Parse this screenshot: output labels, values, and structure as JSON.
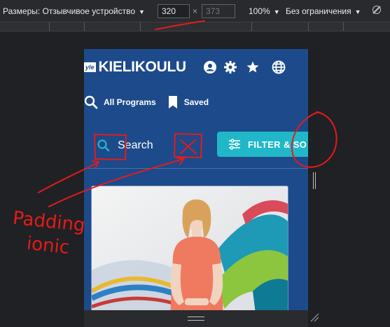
{
  "devtools": {
    "dimensions_label": "Размеры: Отзывчивое устройство",
    "width_value": "320",
    "height_placeholder": "373",
    "zoom_label": "100%",
    "throttle_label": "Без ограничения"
  },
  "app": {
    "logo_badge": "yle",
    "logo_text_bold": "KIELI",
    "logo_text_light": "KOULU",
    "nav": {
      "all_programs": "All Programs",
      "saved": "Saved"
    },
    "toolbar": {
      "search_label": "Search",
      "filter_label": "FILTER & SO"
    }
  },
  "annotations": {
    "note_line1": "Padding",
    "note_line2": "ionic",
    "color": "#e41b1b"
  },
  "colors": {
    "app_background": "#1d4a8a",
    "filter_button": "#20b8c8",
    "search_icon": "#20b8c8"
  }
}
